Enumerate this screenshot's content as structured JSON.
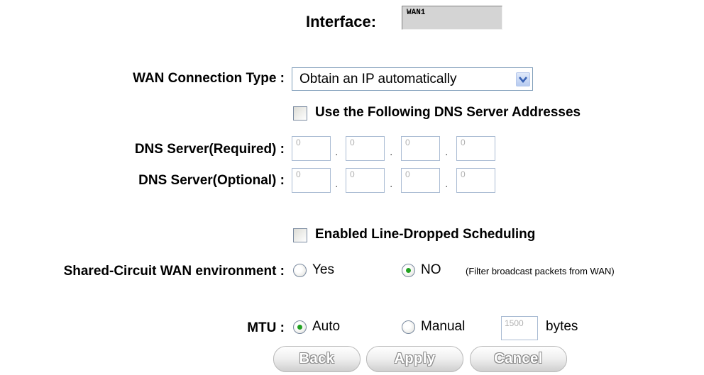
{
  "interface": {
    "label": "Interface:",
    "value": "WAN1"
  },
  "wan_connection_type": {
    "label": "WAN  Connection Type :",
    "selected": "Obtain an IP automatically"
  },
  "dns": {
    "use_following_label": "Use the Following DNS Server Addresses",
    "use_following_checked": false,
    "required": {
      "label": "DNS Server(Required) :",
      "octets": [
        "0",
        "0",
        "0",
        "0"
      ]
    },
    "optional": {
      "label": "DNS Server(Optional) :",
      "octets": [
        "0",
        "0",
        "0",
        "0"
      ]
    },
    "separator": "."
  },
  "line_dropped": {
    "label": "Enabled Line-Dropped Scheduling",
    "checked": false
  },
  "shared_circuit": {
    "label": "Shared-Circuit WAN environment :",
    "options": [
      {
        "label": "Yes",
        "selected": false
      },
      {
        "label": "NO",
        "selected": true
      }
    ],
    "note": "(Filter broadcast packets from WAN)"
  },
  "mtu": {
    "label": "MTU :",
    "options": [
      {
        "label": "Auto",
        "selected": true
      },
      {
        "label": "Manual",
        "selected": false
      }
    ],
    "value": "1500",
    "unit": "bytes"
  },
  "buttons": {
    "back": "Back",
    "apply": "Apply",
    "cancel": "Cancel"
  },
  "colors": {
    "radio_selected": "#21a121",
    "field_border": "#a9bbd3"
  }
}
